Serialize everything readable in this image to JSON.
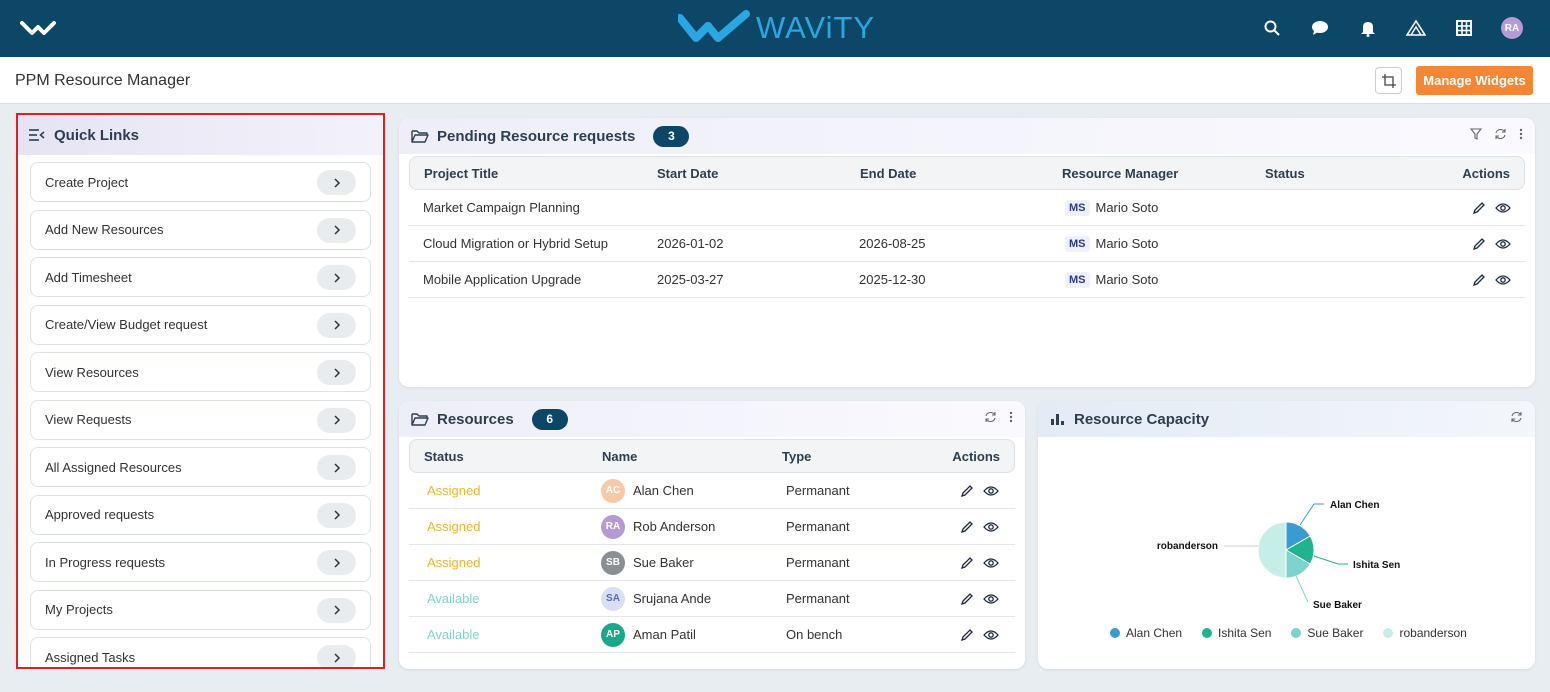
{
  "brand": {
    "name": "WAViTY"
  },
  "topbar": {
    "avatar_initials": "RA"
  },
  "page": {
    "title": "PPM Resource Manager",
    "manage_widgets_label": "Manage Widgets"
  },
  "quick_links": {
    "title": "Quick Links",
    "items": [
      "Create Project",
      "Add New Resources",
      "Add Timesheet",
      "Create/View Budget request",
      "View Resources",
      "View Requests",
      "All Assigned Resources",
      "Approved requests",
      "In Progress requests",
      "My Projects",
      "Assigned Tasks"
    ]
  },
  "pending": {
    "title": "Pending Resource requests",
    "count": "3",
    "columns": [
      "Project Title",
      "Start Date",
      "End Date",
      "Resource Manager",
      "Status",
      "Actions"
    ],
    "rows": [
      {
        "project": "Market Campaign Planning",
        "start": "",
        "end": "",
        "manager_initials": "MS",
        "manager": "Mario Soto",
        "status": ""
      },
      {
        "project": "Cloud Migration or Hybrid Setup",
        "start": "2026-01-02",
        "end": "2026-08-25",
        "manager_initials": "MS",
        "manager": "Mario Soto",
        "status": ""
      },
      {
        "project": "Mobile Application Upgrade",
        "start": "2025-03-27",
        "end": "2025-12-30",
        "manager_initials": "MS",
        "manager": "Mario Soto",
        "status": ""
      }
    ]
  },
  "resources": {
    "title": "Resources",
    "count": "6",
    "columns": [
      "Status",
      "Name",
      "Type",
      "Actions"
    ],
    "rows": [
      {
        "status": "Assigned",
        "initials": "AC",
        "name": "Alan Chen",
        "type": "Permanant",
        "avatar_color": "#f7c9a6",
        "status_color": "#f0b429"
      },
      {
        "status": "Assigned",
        "initials": "RA",
        "name": "Rob Anderson",
        "type": "Permanant",
        "avatar_color": "#b59ad6",
        "status_color": "#f0b429"
      },
      {
        "status": "Assigned",
        "initials": "SB",
        "name": "Sue Baker",
        "type": "Permanant",
        "avatar_color": "#8a8f94",
        "status_color": "#f0b429"
      },
      {
        "status": "Available",
        "initials": "SA",
        "name": "Srujana Ande",
        "type": "Permanant",
        "avatar_color": "#d9e0f5",
        "status_color": "#7fd3cf"
      },
      {
        "status": "Available",
        "initials": "AP",
        "name": "Aman Patil",
        "type": "On bench",
        "avatar_color": "#1aa88a",
        "status_color": "#7fd3cf"
      }
    ]
  },
  "capacity": {
    "title": "Resource Capacity"
  },
  "chart_data": {
    "type": "pie",
    "title": "Resource Capacity",
    "categories": [
      "Alan Chen",
      "Ishita Sen",
      "Sue Baker",
      "robanderson"
    ],
    "values": [
      1,
      1,
      1,
      3
    ],
    "colors": [
      "#3a9bd1",
      "#1fb48f",
      "#7fd3cf",
      "#c6eee9"
    ],
    "legend": "bottom"
  }
}
